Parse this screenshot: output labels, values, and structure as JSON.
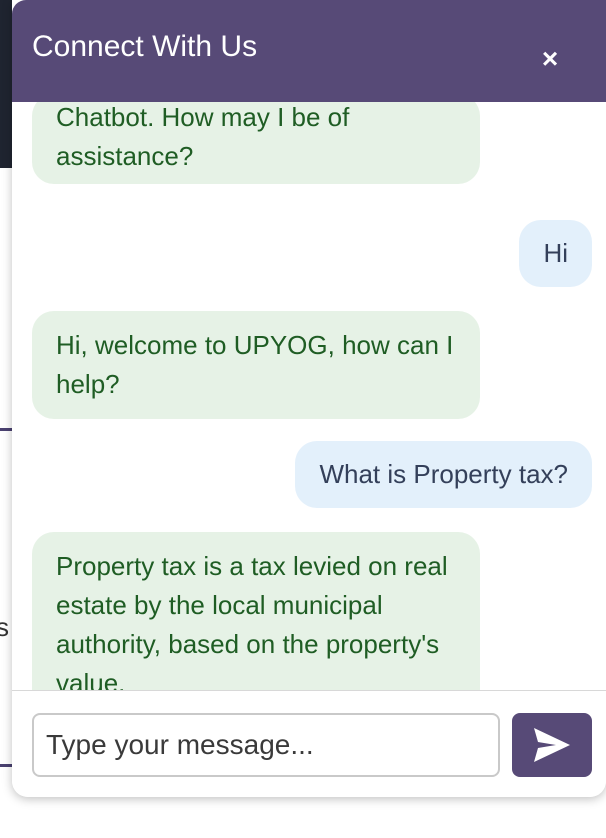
{
  "header": {
    "title": "Connect With Us",
    "close_symbol": "×"
  },
  "messages": [
    {
      "from": "bot",
      "text": "Chatbot. How may I be of assistance?"
    },
    {
      "from": "user",
      "text": "Hi"
    },
    {
      "from": "bot",
      "text": "Hi, welcome to UPYOG, how can I help?"
    },
    {
      "from": "user",
      "text": "What is Property tax?"
    },
    {
      "from": "bot",
      "text": "Property tax is a tax levied on real estate by the local municipal authority, based on the property's value."
    }
  ],
  "composer": {
    "placeholder": "Type your message...",
    "value": ""
  },
  "icons": {
    "close": "close-icon",
    "send": "send-icon"
  },
  "colors": {
    "header_bg": "#574a77",
    "bot_bubble_bg": "#e6f2e6",
    "bot_text": "#1f5d24",
    "user_bubble_bg": "#e3f0fb",
    "user_text": "#34405a",
    "send_button_bg": "#574a77"
  }
}
